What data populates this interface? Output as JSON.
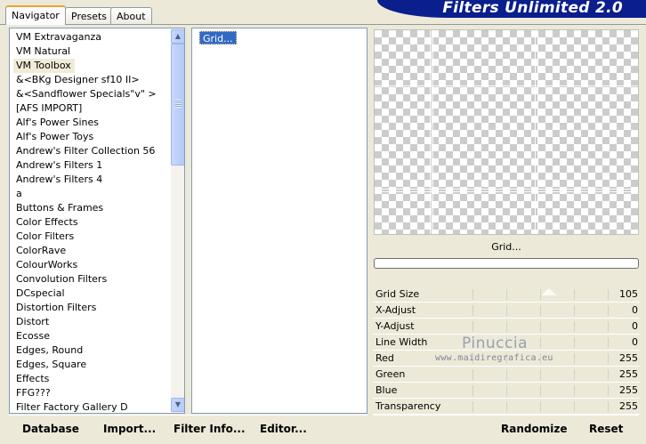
{
  "app": {
    "title": "Filters Unlimited 2.0"
  },
  "tabs": [
    {
      "label": "Navigator"
    },
    {
      "label": "Presets"
    },
    {
      "label": "About"
    }
  ],
  "categories": {
    "selected": "VM Toolbox",
    "items": [
      "VM Extravaganza",
      "VM Natural",
      "VM Toolbox",
      "&<BKg Designer sf10 II>",
      "&<Sandflower Specials\"v\" >",
      "[AFS IMPORT]",
      "Alf's Power Sines",
      "Alf's Power Toys",
      "Andrew's Filter Collection 56",
      "Andrew's Filters 1",
      "Andrew's Filters 4",
      "a",
      "Buttons & Frames",
      "Color Effects",
      "Color Filters",
      "ColorRave",
      "ColourWorks",
      "Convolution Filters",
      "DCspecial",
      "Distortion Filters",
      "Distort",
      "Ecosse",
      "Edges, Round",
      "Edges, Square",
      "Effects",
      "FFG???",
      "Filter Factory Gallery D"
    ]
  },
  "filters": {
    "items": [
      "Grid..."
    ]
  },
  "preview": {
    "filter_name": "Grid..."
  },
  "params": [
    {
      "label": "Grid Size",
      "value": "105"
    },
    {
      "label": "X-Adjust",
      "value": "0"
    },
    {
      "label": "Y-Adjust",
      "value": "0"
    },
    {
      "label": "Line Width",
      "value": "0"
    },
    {
      "label": "Red",
      "value": "255"
    },
    {
      "label": "Green",
      "value": "255"
    },
    {
      "label": "Blue",
      "value": "255"
    },
    {
      "label": "Transparency",
      "value": "255"
    }
  ],
  "watermark": {
    "name": "Pinuccia",
    "url": "www.maidiregrafica.eu"
  },
  "buttons": {
    "database": "Database",
    "import": "Import...",
    "filter_info": "Filter Info...",
    "editor": "Editor...",
    "randomize": "Randomize",
    "reset": "Reset"
  },
  "colors": {
    "banner": "#0a1e8c",
    "selection": "#316ac5",
    "window_bg": "#ece9d8"
  }
}
